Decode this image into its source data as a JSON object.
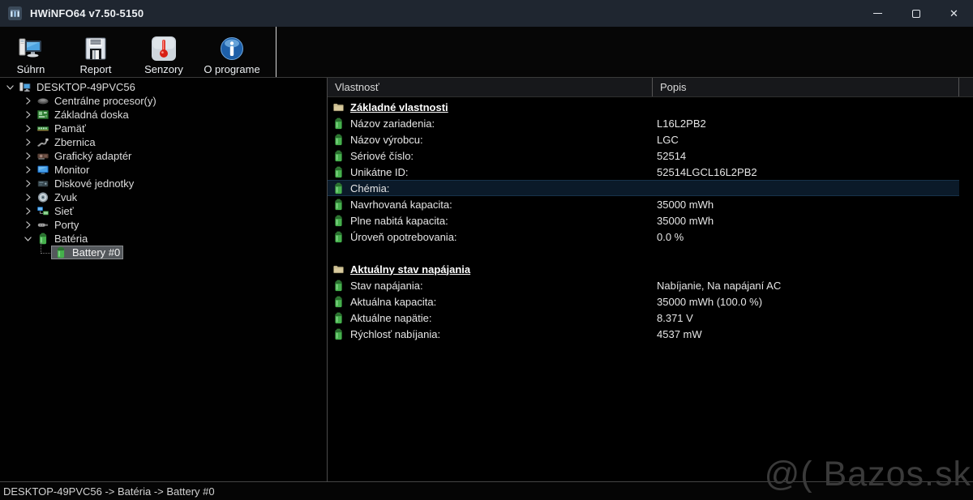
{
  "window": {
    "title": "HWiNFO64 v7.50-5150",
    "controls": {
      "minimize": "minimize",
      "maximize": "maximize",
      "close": "✕"
    }
  },
  "toolbar": {
    "items": [
      {
        "label": "Súhrn",
        "icon": "summary-computer-icon"
      },
      {
        "label": "Report",
        "icon": "report-floppy-icon"
      },
      {
        "label": "Senzory",
        "icon": "sensors-thermometer-icon"
      },
      {
        "label": "O programe",
        "icon": "about-info-icon"
      }
    ]
  },
  "tree": {
    "items": [
      {
        "label": "DESKTOP-49PVC56",
        "icon": "computer-icon",
        "level": 0,
        "chevron": "down"
      },
      {
        "label": "Centrálne procesor(y)",
        "icon": "cpu-icon",
        "level": 1,
        "chevron": "right"
      },
      {
        "label": "Základná doska",
        "icon": "motherboard-icon",
        "level": 1,
        "chevron": "right"
      },
      {
        "label": "Pamäť",
        "icon": "memory-icon",
        "level": 1,
        "chevron": "right"
      },
      {
        "label": "Zbernica",
        "icon": "bus-icon",
        "level": 1,
        "chevron": "right"
      },
      {
        "label": "Grafický adaptér",
        "icon": "gpu-icon",
        "level": 1,
        "chevron": "right"
      },
      {
        "label": "Monitor",
        "icon": "monitor-icon",
        "level": 1,
        "chevron": "right"
      },
      {
        "label": "Diskové jednotky",
        "icon": "disk-icon",
        "level": 1,
        "chevron": "right"
      },
      {
        "label": "Zvuk",
        "icon": "audio-icon",
        "level": 1,
        "chevron": "right"
      },
      {
        "label": "Sieť",
        "icon": "network-icon",
        "level": 1,
        "chevron": "right"
      },
      {
        "label": "Porty",
        "icon": "ports-icon",
        "level": 1,
        "chevron": "right"
      },
      {
        "label": "Batéria",
        "icon": "battery-icon",
        "level": 1,
        "chevron": "down"
      },
      {
        "label": "Battery #0",
        "icon": "battery-icon",
        "level": 2,
        "chevron": null,
        "selected": true
      }
    ]
  },
  "table": {
    "columns": [
      "Vlastnosť",
      "Popis"
    ],
    "sections": [
      {
        "header": "Základné vlastnosti",
        "icon": "folder-icon",
        "rows": [
          {
            "property": "Názov zariadenia:",
            "value": "L16L2PB2",
            "icon": "battery-icon"
          },
          {
            "property": "Názov výrobcu:",
            "value": "LGC",
            "icon": "battery-icon"
          },
          {
            "property": "Sériové číslo:",
            "value": "52514",
            "icon": "battery-icon"
          },
          {
            "property": "Unikátne ID:",
            "value": "52514LGCL16L2PB2",
            "icon": "battery-icon"
          },
          {
            "property": "Chémia:",
            "value": "",
            "icon": "battery-icon",
            "selected": true
          },
          {
            "property": "Navrhovaná kapacita:",
            "value": "35000 mWh",
            "icon": "battery-icon"
          },
          {
            "property": "Plne nabitá kapacita:",
            "value": "35000 mWh",
            "icon": "battery-icon"
          },
          {
            "property": "Úroveň opotrebovania:",
            "value": "0.0 %",
            "icon": "battery-icon"
          }
        ]
      },
      {
        "header": "Aktuálny stav napájania",
        "icon": "folder-icon",
        "rows": [
          {
            "property": "Stav napájania:",
            "value": "Nabíjanie, Na napájaní AC",
            "icon": "battery-icon"
          },
          {
            "property": "Aktuálna kapacita:",
            "value": "35000 mWh (100.0 %)",
            "icon": "battery-icon"
          },
          {
            "property": "Aktuálne napätie:",
            "value": "8.371 V",
            "icon": "battery-icon"
          },
          {
            "property": "Rýchlosť nabíjania:",
            "value": "4537 mW",
            "icon": "battery-icon"
          }
        ]
      }
    ]
  },
  "statusbar": {
    "text": "DESKTOP-49PVC56 -> Batéria -> Battery #0"
  },
  "watermark": {
    "text": "@( Bazos.sk"
  },
  "colors": {
    "titlebar": "#1f2630",
    "toolbar_bg": "#060606",
    "panel_bg": "#000000",
    "header_bg": "#17181b",
    "selection_navy": "#0b1a29",
    "tree_selection_gray": "#54585c",
    "battery_green": "#45b04c",
    "folder_tan": "#d9cb9e",
    "text": "#e6e6e6"
  }
}
